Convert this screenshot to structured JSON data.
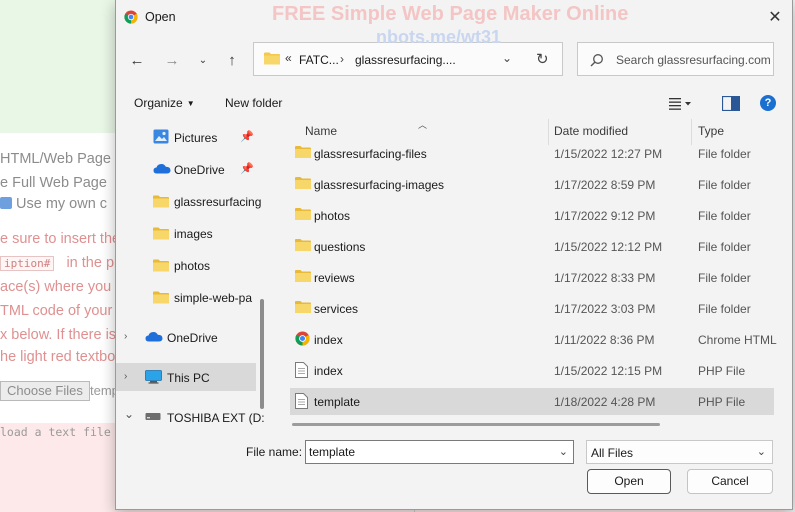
{
  "background_page": {
    "watermark_title": "FREE Simple Web Page Maker Online",
    "watermark_url": "nbots.me/wt31",
    "lines": [
      "HTML/Web Page",
      "e Full Web Page",
      "Use my own c",
      "e sure to insert the",
      "iption#",
      "in the pla",
      "ace(s) where you",
      "TML code of your a",
      "x below. If there is",
      "he light red textbox"
    ],
    "choose_files": "Choose Files",
    "choose_files_next": "temp",
    "load_text": "load a text file"
  },
  "dialog": {
    "title": "Open",
    "address": {
      "chevron": "«",
      "segment1": "FATC...",
      "separator": "›",
      "segment2": "glassresurfacing...."
    },
    "search_placeholder": "Search glassresurfacing.com",
    "toolbar": {
      "organize": "Organize",
      "new_folder": "New folder"
    },
    "nav_items": [
      {
        "label": "Pictures",
        "icon": "pictures-icon",
        "pinned": true
      },
      {
        "label": "OneDrive",
        "icon": "onedrive-icon",
        "pinned": true
      },
      {
        "label": "glassresurfacing",
        "icon": "folder-icon",
        "pinned": false
      },
      {
        "label": "images",
        "icon": "folder-icon",
        "pinned": false
      },
      {
        "label": "photos",
        "icon": "folder-icon",
        "pinned": false
      },
      {
        "label": "simple-web-pa",
        "icon": "folder-icon",
        "pinned": false
      },
      {
        "label": "OneDrive",
        "icon": "onedrive-icon",
        "expander": "›"
      },
      {
        "label": "This PC",
        "icon": "pc-icon",
        "expander": "›",
        "selected": true
      },
      {
        "label": "TOSHIBA EXT (D:)",
        "icon": "drive-icon",
        "expander": "⌄"
      }
    ],
    "columns": {
      "name": "Name",
      "date": "Date modified",
      "type": "Type"
    },
    "files": [
      {
        "name": "glassresurfacing-files",
        "date": "1/15/2022 12:27 PM",
        "type": "File folder",
        "icon": "folder-icon"
      },
      {
        "name": "glassresurfacing-images",
        "date": "1/17/2022 8:59 PM",
        "type": "File folder",
        "icon": "folder-icon"
      },
      {
        "name": "photos",
        "date": "1/17/2022 9:12 PM",
        "type": "File folder",
        "icon": "folder-icon"
      },
      {
        "name": "questions",
        "date": "1/15/2022 12:12 PM",
        "type": "File folder",
        "icon": "folder-icon"
      },
      {
        "name": "reviews",
        "date": "1/17/2022 8:33 PM",
        "type": "File folder",
        "icon": "folder-icon"
      },
      {
        "name": "services",
        "date": "1/17/2022 3:03 PM",
        "type": "File folder",
        "icon": "folder-icon"
      },
      {
        "name": "index",
        "date": "1/11/2022 8:36 PM",
        "type": "Chrome HTML",
        "icon": "chrome-icon"
      },
      {
        "name": "index",
        "date": "1/15/2022 12:15 PM",
        "type": "PHP File",
        "icon": "file-icon"
      },
      {
        "name": "template",
        "date": "1/18/2022 4:28 PM",
        "type": "PHP File",
        "icon": "file-icon",
        "selected": true
      }
    ],
    "file_name_label": "File name:",
    "file_name_value": "template",
    "file_type": "All Files",
    "open_button": "Open",
    "cancel_button": "Cancel",
    "help": "?",
    "colors": {
      "folder": "#f2c94c",
      "selection": "#d9d9d9",
      "help": "#1a6fd0",
      "onedrive": "#1e6fd9"
    }
  }
}
